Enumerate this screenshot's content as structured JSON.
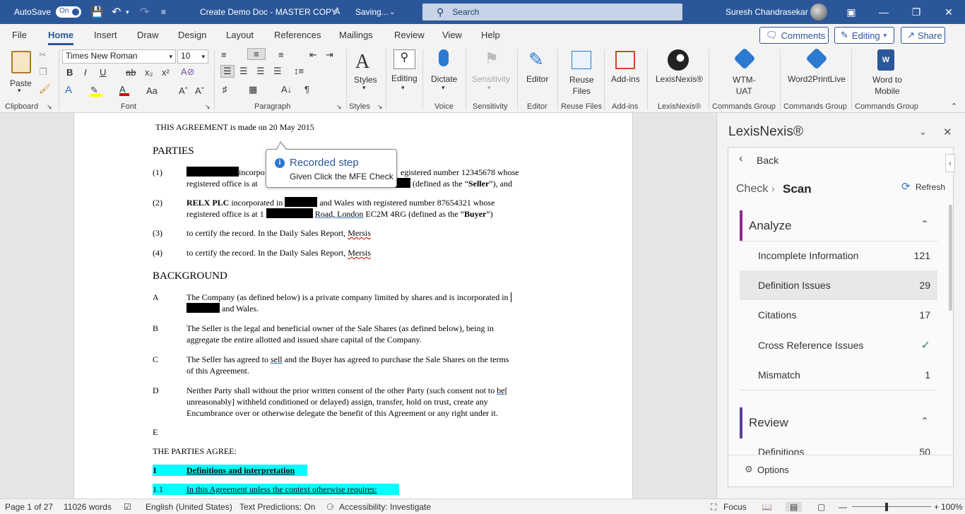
{
  "titlebar": {
    "autosave_label": "AutoSave",
    "autosave_state": "On",
    "doc_title": "Create Demo Doc - MASTER COPY",
    "saving_status": "Saving...",
    "search_placeholder": "Search",
    "user_name": "Suresh Chandrasekar"
  },
  "tabs": [
    "File",
    "Home",
    "Insert",
    "Draw",
    "Design",
    "Layout",
    "References",
    "Mailings",
    "Review",
    "View",
    "Help"
  ],
  "active_tab": "Home",
  "header_buttons": {
    "comments": "Comments",
    "editing": "Editing",
    "share": "Share"
  },
  "ribbon": {
    "clipboard": {
      "paste": "Paste",
      "label": "Clipboard"
    },
    "font": {
      "name": "Times New Roman",
      "size": "10",
      "label": "Font"
    },
    "paragraph": {
      "label": "Paragraph"
    },
    "styles": {
      "button": "Styles",
      "label": "Styles"
    },
    "editing": {
      "button": "Editing"
    },
    "voice": {
      "button": "Dictate",
      "label": "Voice"
    },
    "sensitivity": {
      "button": "Sensitivity",
      "label": "Sensitivity"
    },
    "editor": {
      "button": "Editor",
      "label": "Editor"
    },
    "reuse": {
      "button_line1": "Reuse",
      "button_line2": "Files",
      "label": "Reuse Files"
    },
    "addins": {
      "button": "Add-ins",
      "label": "Add-ins"
    },
    "lexis": {
      "button": "LexisNexis®",
      "label": "LexisNexis®"
    },
    "wtm": {
      "button_line1": "WTM-",
      "button_line2": "UAT",
      "label": "Commands Group"
    },
    "w2p": {
      "button": "Word2PrintLive",
      "label": "Commands Group"
    },
    "w2m": {
      "button_line1": "Word to",
      "button_line2": "Mobile",
      "label": "Commands Group"
    }
  },
  "document": {
    "intro": "THIS AGREEMENT is made on 20 May 2015",
    "parties_heading": "PARTIES",
    "p1_num": "(1)",
    "p1_a": "incorpo",
    "p1_b": "egistered number 12345678 whose",
    "p1_c": "registered office is at",
    "p1_d": "(defined as the “",
    "p1_seller": "Seller",
    "p1_e": "”), and",
    "p2_num": "(2)",
    "p2_relx": "RELX PLC",
    "p2_a": " incorporated in ",
    "p2_b": " and Wales with registered number 87654321 whose",
    "p2_c": "registered office is at 1 ",
    "p2_road": "Road,  London",
    "p2_d": " EC2M 4RG (defined as the “",
    "p2_buyer": "Buyer",
    "p2_e": "”)",
    "p3_num": "(3)",
    "p3_text": "to certify the record. In the Daily Sales Report, ",
    "p3_word": "Mersis",
    "p4_num": "(4)",
    "p4_text": "to certify the record. In the Daily Sales Report, ",
    "p4_word": "Mersis",
    "background_heading": "BACKGROUND",
    "a_lbl": "A",
    "a_line1": "The Company (as defined below) is a private company limited by shares and is incorporated in",
    "a_line2": " and Wales.",
    "b_lbl": "B",
    "b_line1": "The Seller is the legal and beneficial owner of the Sale Shares (as defined below), being in",
    "b_line2": "aggregate the entire allotted and issued share capital of the Company.",
    "c_lbl": "C",
    "c_line1a": "The Seller has agreed to ",
    "c_sell": "sell",
    "c_line1b": " and the Buyer has agreed to purchase the Sale Shares on the terms",
    "c_line2": "of this Agreement.",
    "d_lbl": "D",
    "d_line1a": "Neither Party shall without the prior written consent of the other Party (such consent not to ",
    "d_be": "be[",
    "d_line2": "unreasonably] withheld conditioned or delayed) assign, transfer, hold on trust, create any",
    "d_line3": "Encumbrance over or otherwise delegate the benefit of this Agreement or any right under it.",
    "e_lbl": "E",
    "agree": "THE PARTIES AGREE:",
    "s1_num": "1",
    "s1_title": "Definitions and interpretation",
    "s11_num": "1.1",
    "s11_text": "In this Agreement unless the context otherwise requires:"
  },
  "callout": {
    "title": "Recorded step",
    "body": "Given Click the MFE Check"
  },
  "pane": {
    "title": "LexisNexis®",
    "back": "Back",
    "crumb_check": "Check",
    "crumb_scan": "Scan",
    "refresh": "Refresh",
    "analyze": "Analyze",
    "rows": [
      {
        "label": "Incomplete Information",
        "count": "121"
      },
      {
        "label": "Definition Issues",
        "count": "29"
      },
      {
        "label": "Citations",
        "count": "17"
      },
      {
        "label": "Cross Reference Issues",
        "count": "✓"
      },
      {
        "label": "Mismatch",
        "count": "1"
      }
    ],
    "review": "Review",
    "review_first": "Definitions",
    "review_first_count": "50",
    "options": "Options"
  },
  "status": {
    "page": "Page 1 of 27",
    "words": "11026 words",
    "language": "English (United States)",
    "predictions": "Text Predictions: On",
    "accessibility": "Accessibility: Investigate",
    "focus": "Focus",
    "zoom": "100%"
  },
  "colors": {
    "word_blue": "#2b579a",
    "highlight": "#00ffff",
    "pane_accent": "#8b2a8b",
    "review_accent": "#5b3f99"
  }
}
